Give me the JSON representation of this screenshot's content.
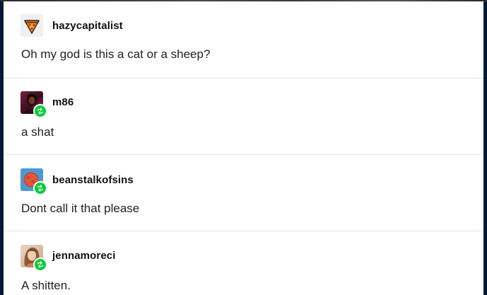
{
  "posts": [
    {
      "username": "hazycapitalist",
      "text": "Oh my god is this a cat or a sheep?",
      "avatar_icon": "pizza-slice-icon",
      "reblogged": false
    },
    {
      "username": "m86",
      "text": "a shat",
      "avatar_icon": "person-photo-icon",
      "reblogged": true
    },
    {
      "username": "beanstalkofsins",
      "text": "Dont call it that please",
      "avatar_icon": "red-planet-icon",
      "reblogged": true
    },
    {
      "username": "jennamoreci",
      "text": "A shitten.",
      "avatar_icon": "woman-photo-icon",
      "reblogged": true
    }
  ],
  "colors": {
    "page_background": "#001935",
    "card_background": "#ffffff",
    "reblog_badge": "#00cf35",
    "divider": "#e6e6e6"
  }
}
